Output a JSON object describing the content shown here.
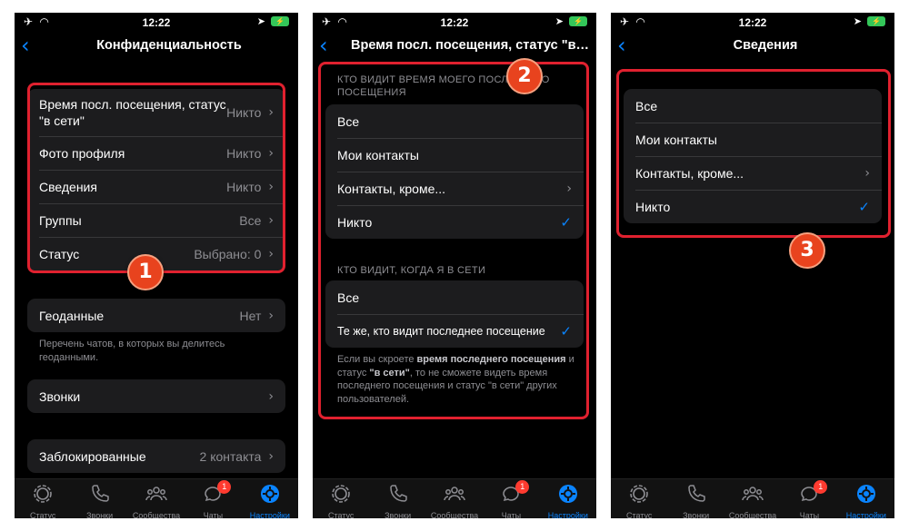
{
  "colors": {
    "accent": "#0a84ff",
    "highlight": "#e0212f",
    "step_badge": "#e8431e",
    "battery": "#34c759"
  },
  "statusbar": {
    "time": "12:22",
    "battery": "⚡"
  },
  "tabbar": {
    "items": [
      {
        "label": "Статус",
        "icon": "status-icon"
      },
      {
        "label": "Звонки",
        "icon": "phone-icon"
      },
      {
        "label": "Сообщества",
        "icon": "communities-icon"
      },
      {
        "label": "Чаты",
        "icon": "chats-icon",
        "badge": "1"
      },
      {
        "label": "Настройки",
        "icon": "settings-icon",
        "active": true
      }
    ]
  },
  "screen1": {
    "title": "Конфиденциальность",
    "group1": [
      {
        "label": "Время посл. посещения, статус \"в сети\"",
        "value": "Никто"
      },
      {
        "label": "Фото профиля",
        "value": "Никто"
      },
      {
        "label": "Сведения",
        "value": "Никто"
      },
      {
        "label": "Группы",
        "value": "Все"
      },
      {
        "label": "Статус",
        "value": "Выбрано: 0"
      }
    ],
    "geo": {
      "label": "Геоданные",
      "value": "Нет",
      "footnote": "Перечень чатов, в которых вы делитесь геоданными."
    },
    "calls": {
      "label": "Звонки"
    },
    "blocked": {
      "label": "Заблокированные",
      "value": "2 контакта"
    },
    "step": "1"
  },
  "screen2": {
    "title": "Время посл. посещения, статус \"в с...",
    "section1_header": "КТО ВИДИТ ВРЕМЯ МОЕГО ПОСЛЕДНЕГО ПОСЕЩЕНИЯ",
    "section1_options": [
      "Все",
      "Мои контакты",
      "Контакты, кроме...",
      "Никто"
    ],
    "section2_header": "КТО ВИДИТ, КОГДА Я В СЕТИ",
    "section2_options": [
      "Все",
      "Те же, кто видит последнее посещение"
    ],
    "footnote": {
      "part1": "Если вы скроете ",
      "bold1": "время последнего посещения",
      "part2": " и статус ",
      "bold2": "\"в сети\"",
      "part3": ", то не сможете видеть время последнего посещения и статус \"в сети\" других пользователей."
    },
    "step": "2"
  },
  "screen3": {
    "title": "Сведения",
    "options": [
      "Все",
      "Мои контакты",
      "Контакты, кроме...",
      "Никто"
    ],
    "step": "3"
  }
}
